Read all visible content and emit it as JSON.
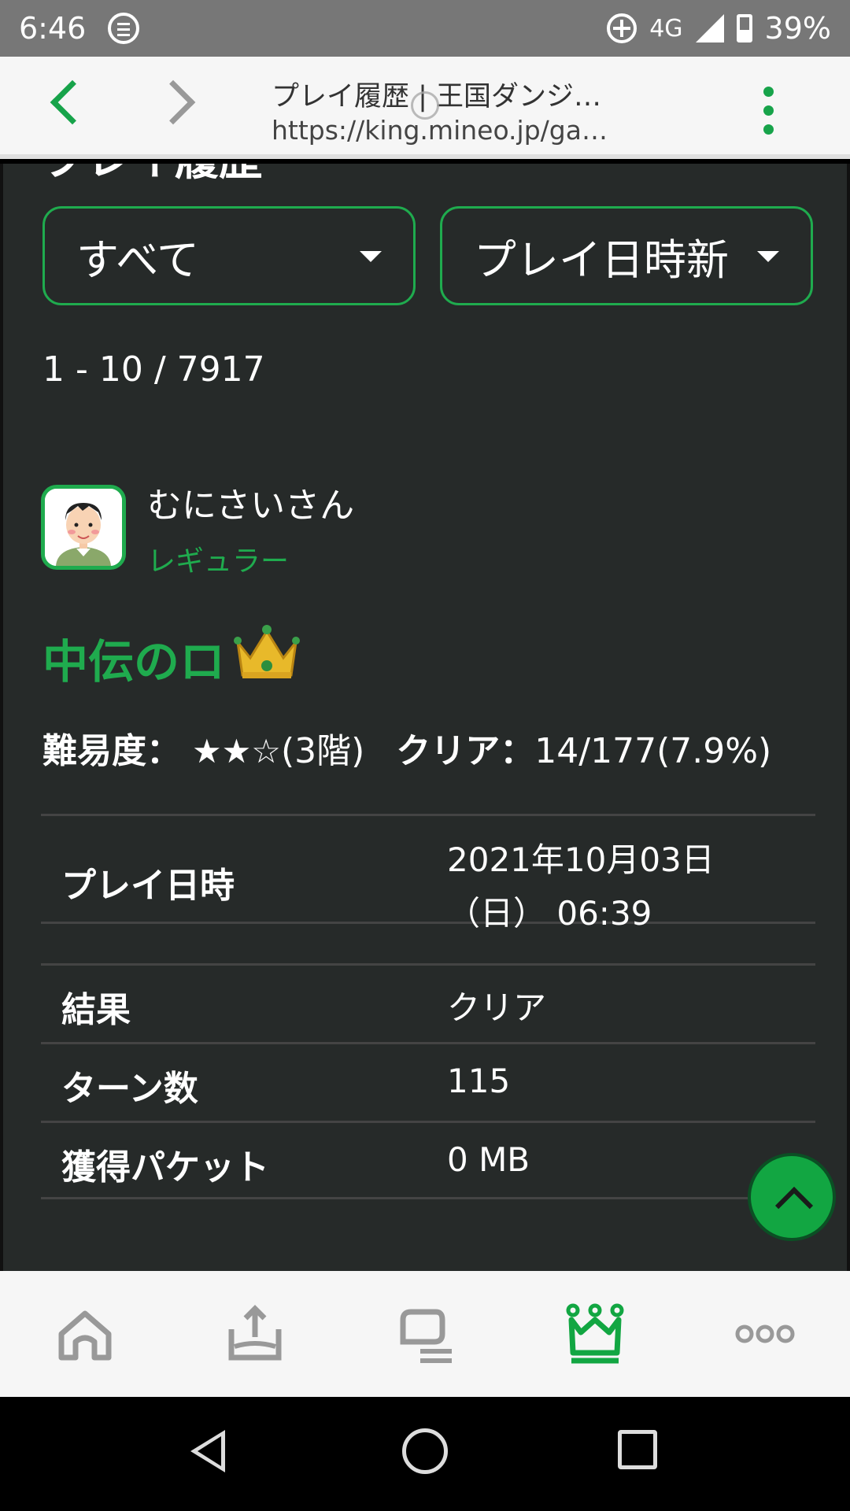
{
  "status_bar": {
    "time": "6:46",
    "network": "4G",
    "battery": "39%"
  },
  "browser": {
    "title": "プレイ履歴 | 王国ダンジ…",
    "url": "https://king.mineo.jp/ga…"
  },
  "page": {
    "heading": "プレイ履歴",
    "filter_dropdown": "すべて",
    "sort_dropdown": "プレイ日時新",
    "count_text": "1 - 10 / 7917"
  },
  "user": {
    "name": "むにさいさん",
    "rank": "レギュラー"
  },
  "dungeon": {
    "title": "中伝のロ",
    "difficulty_label": "難易度：",
    "difficulty_stars": "★★☆",
    "difficulty_floor": "(3階)",
    "difficulty_rating": 2,
    "clear_label": "クリア：",
    "clear_value": "14/177(7.9%)"
  },
  "details": {
    "play_time_label": "プレイ日時",
    "play_time_line1": "2021年10月03日",
    "play_time_line2": "（日） 06:39",
    "result_label": "結果",
    "result_value": "クリア",
    "turns_label": "ターン数",
    "turns_value": "115",
    "packet_label": "獲得パケット",
    "packet_value": "0 MB"
  },
  "bottom_tabs": [
    {
      "icon": "home-icon"
    },
    {
      "icon": "upload-tray-icon"
    },
    {
      "icon": "chat-icon"
    },
    {
      "icon": "king-crown-icon",
      "active": true
    },
    {
      "icon": "more-dots-icon"
    }
  ],
  "colors": {
    "accent": "#1fab4e",
    "background": "#262a29"
  }
}
